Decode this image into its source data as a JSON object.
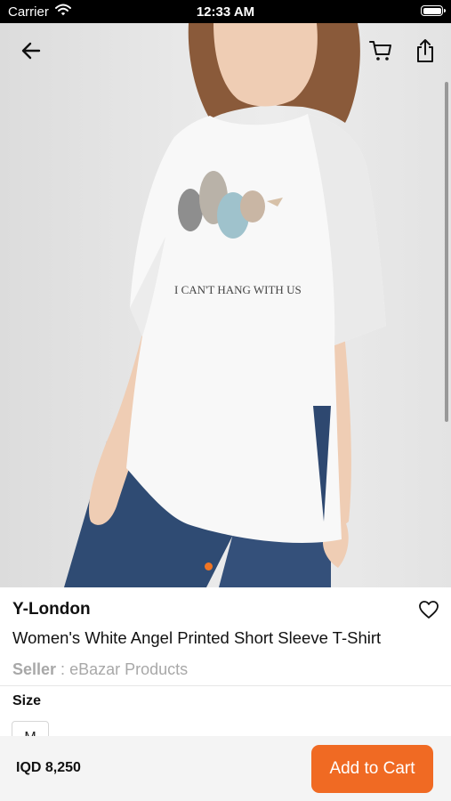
{
  "status_bar": {
    "carrier": "Carrier",
    "time": "12:33 AM"
  },
  "nav": {
    "back_icon": "arrow-left-icon",
    "cart_icon": "cart-icon",
    "share_icon": "share-icon"
  },
  "gallery": {
    "image": "product-photo-white-tshirt",
    "print_text": "I CAN'T HANG WITH US",
    "page_count": 1,
    "active_page": 1,
    "active_color": "#f07524"
  },
  "product": {
    "brand": "Y-London",
    "title": "Women's White Angel Printed Short Sleeve T-Shirt",
    "seller_label": "Seller",
    "seller_separator": " : ",
    "seller_name": "eBazar Products",
    "favorite_icon": "heart-outline-icon"
  },
  "size": {
    "heading": "Size",
    "options": [
      "M"
    ]
  },
  "footer": {
    "price": "IQD 8,250",
    "add_to_cart": "Add to Cart",
    "accent": "#f06a23"
  }
}
